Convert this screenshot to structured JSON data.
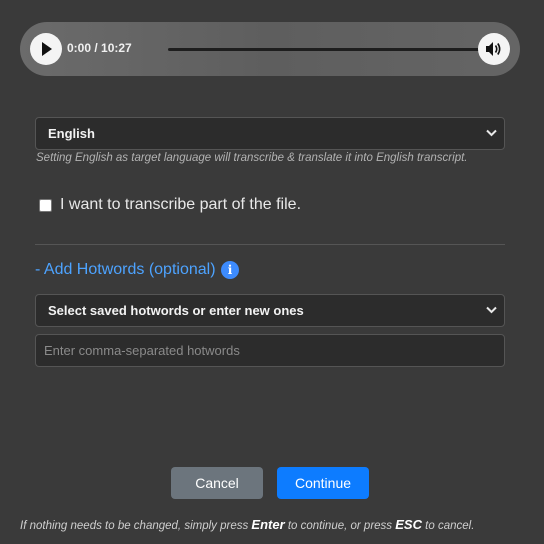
{
  "player": {
    "time_display": "0:00 / 10:27",
    "progress": 0,
    "play_icon": "play-icon",
    "volume_icon": "volume-icon"
  },
  "language": {
    "selected": "English",
    "hint": "Setting English as target language will transcribe & translate it into English transcript."
  },
  "partial": {
    "checked": false,
    "label": "I want to transcribe part of the file."
  },
  "hotwords": {
    "toggle_label": "- Add Hotwords (optional)",
    "info_icon": "i",
    "saved_select": "Select saved hotwords or enter new ones",
    "input_value": "",
    "input_placeholder": "Enter comma-separated hotwords"
  },
  "actions": {
    "cancel": "Cancel",
    "continue": "Continue"
  },
  "footer": {
    "part1": "If nothing needs to be changed, simply press ",
    "key_enter": "Enter",
    "part2": " to continue, or press ",
    "key_esc": "ESC",
    "part3": " to cancel."
  },
  "colors": {
    "background": "#3a3a3a",
    "link": "#4da3ff",
    "primary": "#0d7cff",
    "secondary": "#6c757d"
  }
}
